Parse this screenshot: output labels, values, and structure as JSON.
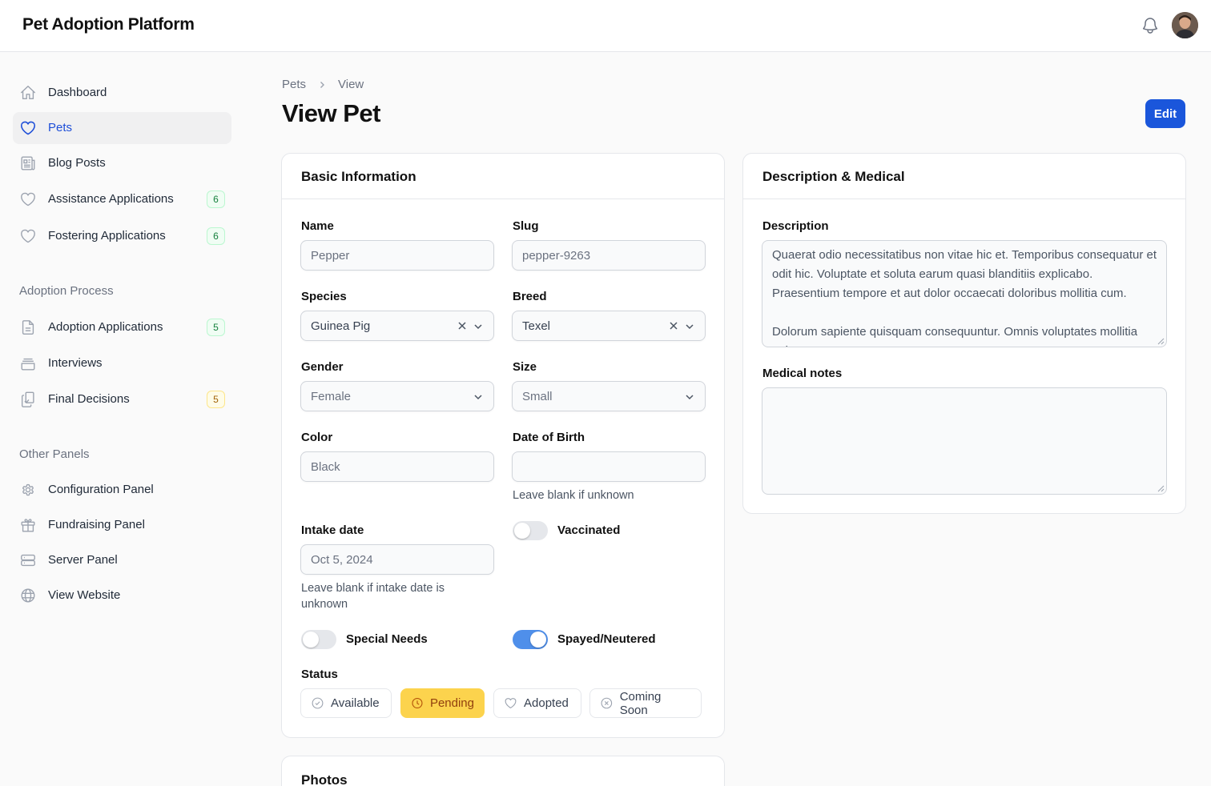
{
  "app": {
    "title": "Pet Adoption Platform"
  },
  "sidebar": {
    "items": [
      {
        "label": "Dashboard",
        "icon": "home-icon"
      },
      {
        "label": "Pets",
        "icon": "heart-icon",
        "active": true
      },
      {
        "label": "Blog Posts",
        "icon": "newspaper-icon"
      },
      {
        "label": "Assistance Applications",
        "icon": "heart-icon",
        "badge": "6"
      },
      {
        "label": "Fostering Applications",
        "icon": "heart-icon",
        "badge": "6"
      }
    ],
    "groups": [
      {
        "label": "Adoption Process",
        "items": [
          {
            "label": "Adoption Applications",
            "icon": "document-icon",
            "badge": "5"
          },
          {
            "label": "Interviews",
            "icon": "inbox-stack-icon"
          },
          {
            "label": "Final Decisions",
            "icon": "clipboard-check-icon",
            "badge": "5"
          }
        ]
      },
      {
        "label": "Other Panels",
        "items": [
          {
            "label": "Configuration Panel",
            "icon": "cog-icon"
          },
          {
            "label": "Fundraising Panel",
            "icon": "gift-icon"
          },
          {
            "label": "Server Panel",
            "icon": "server-icon"
          },
          {
            "label": "View Website",
            "icon": "globe-icon"
          }
        ]
      }
    ]
  },
  "breadcrumb": {
    "parent": "Pets",
    "current": "View"
  },
  "page": {
    "title": "View Pet",
    "edit_label": "Edit"
  },
  "basic": {
    "title": "Basic Information",
    "name": {
      "label": "Name",
      "value": "Pepper"
    },
    "slug": {
      "label": "Slug",
      "value": "pepper-9263"
    },
    "species": {
      "label": "Species",
      "value": "Guinea Pig"
    },
    "breed": {
      "label": "Breed",
      "value": "Texel"
    },
    "gender": {
      "label": "Gender",
      "value": "Female"
    },
    "size": {
      "label": "Size",
      "value": "Small"
    },
    "color": {
      "label": "Color",
      "value": "Black"
    },
    "dob": {
      "label": "Date of Birth",
      "value": "",
      "hint": "Leave blank if unknown"
    },
    "intake": {
      "label": "Intake date",
      "value": "Oct 5, 2024",
      "hint": "Leave blank if intake date is unknown"
    },
    "vaccinated": {
      "label": "Vaccinated",
      "on": false
    },
    "special_needs": {
      "label": "Special Needs",
      "on": false
    },
    "spayed": {
      "label": "Spayed/Neutered",
      "on": true
    },
    "status": {
      "label": "Status",
      "options": [
        "Available",
        "Pending",
        "Adopted",
        "Coming Soon"
      ],
      "selected": "Pending"
    }
  },
  "desc": {
    "title": "Description & Medical",
    "description": {
      "label": "Description",
      "value": "Quaerat odio necessitatibus non vitae hic et. Temporibus consequatur et odit hic. Voluptate et soluta earum quasi blanditiis explicabo. Praesentium tempore et aut dolor occaecati doloribus mollitia cum.\n\nDolorum sapiente quisquam consequuntur. Omnis voluptates mollitia qui"
    },
    "medical": {
      "label": "Medical notes",
      "value": ""
    }
  },
  "photos": {
    "title": "Photos"
  },
  "colors": {
    "accent": "#1a56db",
    "pending": "#fcd34d",
    "toggle_on": "#4f8fea"
  }
}
